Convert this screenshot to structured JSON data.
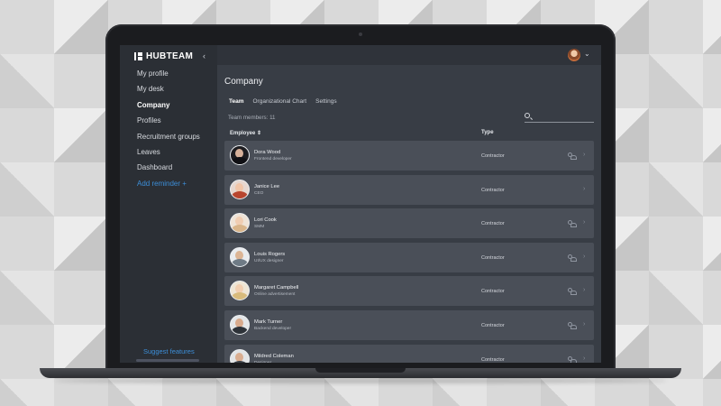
{
  "app": {
    "logo": "HUBTEAM",
    "collapse_icon": "chevron-left-icon"
  },
  "sidebar": {
    "items": [
      {
        "label": "My profile",
        "active": false
      },
      {
        "label": "My desk",
        "active": false
      },
      {
        "label": "Company",
        "active": true
      },
      {
        "label": "Profiles",
        "active": false
      },
      {
        "label": "Recruitment groups",
        "active": false
      },
      {
        "label": "Leaves",
        "active": false
      },
      {
        "label": "Dashboard",
        "active": false
      }
    ],
    "add_reminder": "Add reminder +",
    "suggest": "Suggest features"
  },
  "page": {
    "title": "Company",
    "tabs": [
      {
        "label": "Team",
        "active": true
      },
      {
        "label": "Organizational Chart",
        "active": false
      },
      {
        "label": "Settings",
        "active": false
      }
    ],
    "members": "Team members: 11",
    "search_placeholder": ""
  },
  "table": {
    "columns": {
      "employee": "Employee ⇕",
      "type": "Type"
    },
    "rows": [
      {
        "name": "Dora Wood",
        "role": "Frontend developer",
        "type": "Contractor"
      },
      {
        "name": "Janice Lee",
        "role": "CEO",
        "type": "Contractor"
      },
      {
        "name": "Lori Cook",
        "role": "SMM",
        "type": "Contractor"
      },
      {
        "name": "Louis Rogers",
        "role": "UI/UX designer",
        "type": "Contractor"
      },
      {
        "name": "Margaret Campbell",
        "role": "Online advertisement",
        "type": "Contractor"
      },
      {
        "name": "Mark Turner",
        "role": "Backend developer",
        "type": "Contractor"
      },
      {
        "name": "Mildred Coleman",
        "role": "Designer",
        "type": "Contractor"
      }
    ]
  },
  "colors": {
    "accent": "#3c8ed8",
    "panel": "#383d45",
    "sidebar": "#2b2f35",
    "row": "#4a4f58"
  }
}
